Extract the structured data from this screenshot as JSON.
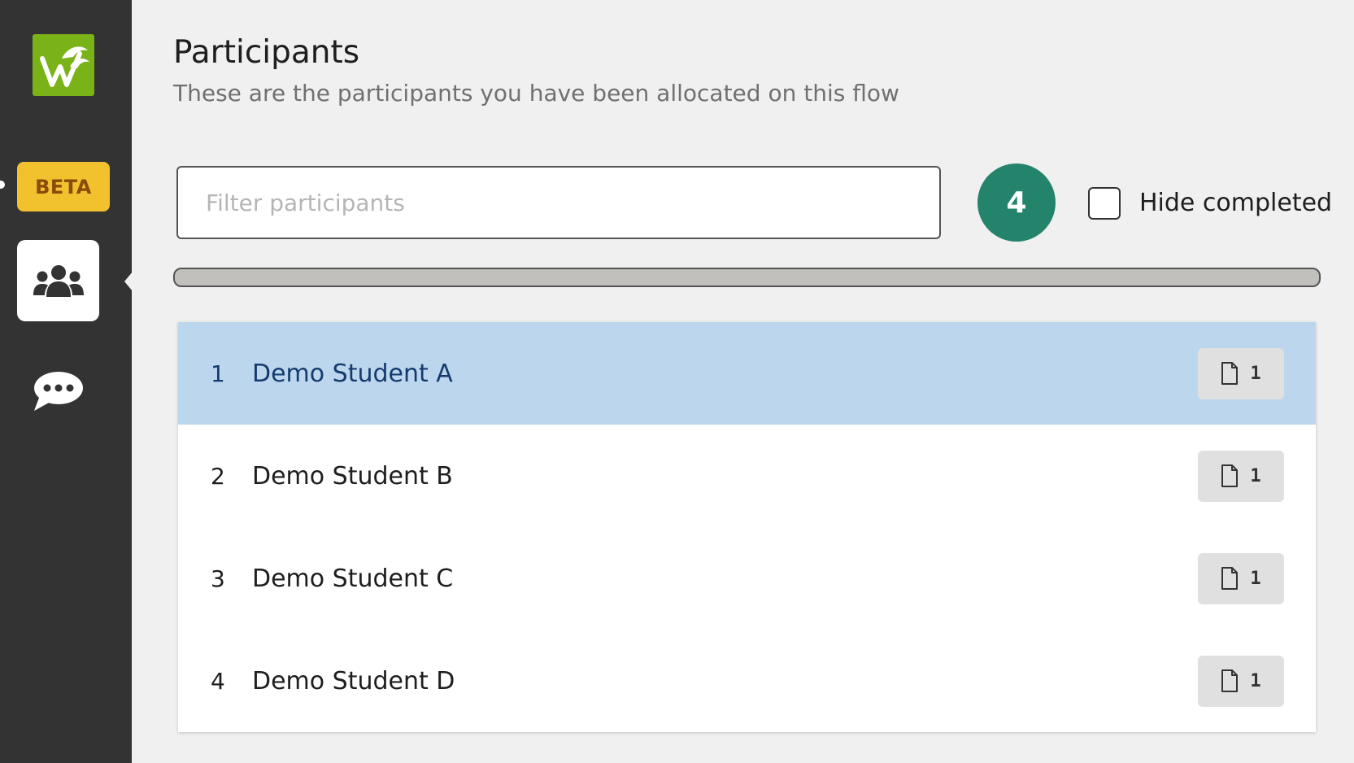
{
  "colors": {
    "sidebar_bg": "#333333",
    "logo_green": "#7ab317",
    "beta_yellow": "#f2c12e",
    "count_teal": "#24836b",
    "selected_row": "#bcd6ee"
  },
  "sidebar": {
    "logo_icon": "dolphin-logo-icon",
    "beta_label": "BETA",
    "items": [
      {
        "name": "participants",
        "icon": "users-icon",
        "active": true
      },
      {
        "name": "messages",
        "icon": "speech-bubble-icon",
        "active": false
      }
    ]
  },
  "header": {
    "title": "Participants",
    "subtitle": "These are the participants you have been allocated on this flow"
  },
  "filter": {
    "placeholder": "Filter participants",
    "value": ""
  },
  "count_badge": "4",
  "hide_completed": {
    "label": "Hide completed",
    "checked": false
  },
  "progress": {
    "fraction": 0
  },
  "participants": [
    {
      "number": "1",
      "name": "Demo Student A",
      "doc_icon": "document-icon",
      "doc_count": "1",
      "selected": true
    },
    {
      "number": "2",
      "name": "Demo Student B",
      "doc_icon": "document-icon",
      "doc_count": "1",
      "selected": false
    },
    {
      "number": "3",
      "name": "Demo Student C",
      "doc_icon": "document-icon",
      "doc_count": "1",
      "selected": false
    },
    {
      "number": "4",
      "name": "Demo Student D",
      "doc_icon": "document-icon",
      "doc_count": "1",
      "selected": false
    }
  ]
}
